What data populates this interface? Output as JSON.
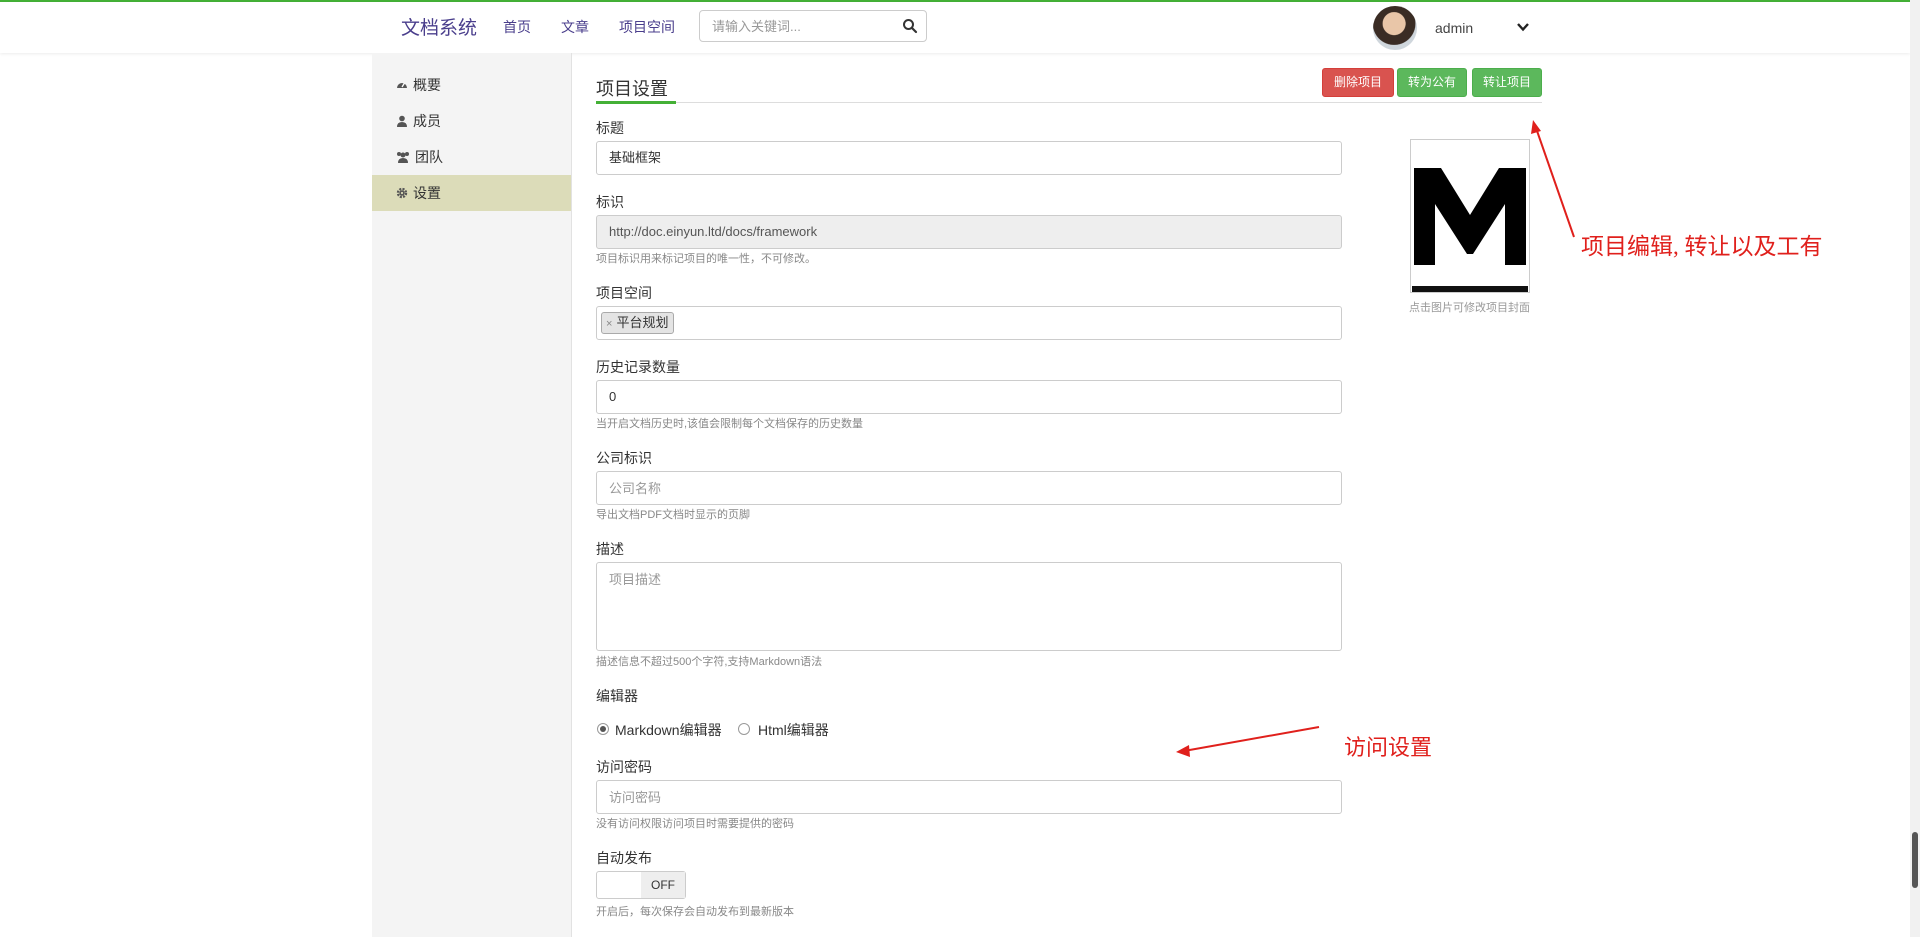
{
  "header": {
    "brand": "文档系统",
    "nav": [
      "首页",
      "文章",
      "项目空间"
    ],
    "search_placeholder": "请输入关键词...",
    "username": "admin"
  },
  "sidebar": {
    "items": [
      {
        "label": "概要",
        "icon": "dashboard-icon"
      },
      {
        "label": "成员",
        "icon": "user-icon"
      },
      {
        "label": "团队",
        "icon": "users-icon"
      },
      {
        "label": "设置",
        "icon": "gear-icon",
        "active": true
      }
    ]
  },
  "page": {
    "title": "项目设置",
    "buttons": {
      "delete": "删除项目",
      "make_public": "转为公有",
      "transfer": "转让项目"
    }
  },
  "form": {
    "title_label": "标题",
    "title_value": "基础框架",
    "ident_label": "标识",
    "ident_value": "http://doc.einyun.ltd/docs/framework",
    "ident_help": "项目标识用来标记项目的唯一性，不可修改。",
    "space_label": "项目空间",
    "space_tag": "平台规划",
    "history_label": "历史记录数量",
    "history_value": "0",
    "history_help": "当开启文档历史时,该值会限制每个文档保存的历史数量",
    "company_label": "公司标识",
    "company_placeholder": "公司名称",
    "company_help": "导出文档PDF文档时显示的页脚",
    "desc_label": "描述",
    "desc_placeholder": "项目描述",
    "desc_help": "描述信息不超过500个字符,支持Markdown语法",
    "editor_label": "编辑器",
    "editor_options": [
      "Markdown编辑器",
      "Html编辑器"
    ],
    "editor_selected": "Markdown编辑器",
    "password_label": "访问密码",
    "password_placeholder": "访问密码",
    "password_help": "没有访问权限访问项目时需要提供的密码",
    "autopub_label": "自动发布",
    "autopub_state": "OFF",
    "autopub_help": "开启后，每次保存会自动发布到最新版本"
  },
  "cover": {
    "letter": "M",
    "caption": "点击图片可修改项目封面"
  },
  "annotations": {
    "top_right": "项目编辑, 转让以及工有",
    "middle": "访问设置",
    "color": "#e0201c"
  },
  "colors": {
    "accent_green": "#44b036",
    "brand_purple": "#4a3e8c",
    "danger": "#d9534f",
    "success": "#5cb85c",
    "sidebar_active": "#dcdcb9"
  }
}
